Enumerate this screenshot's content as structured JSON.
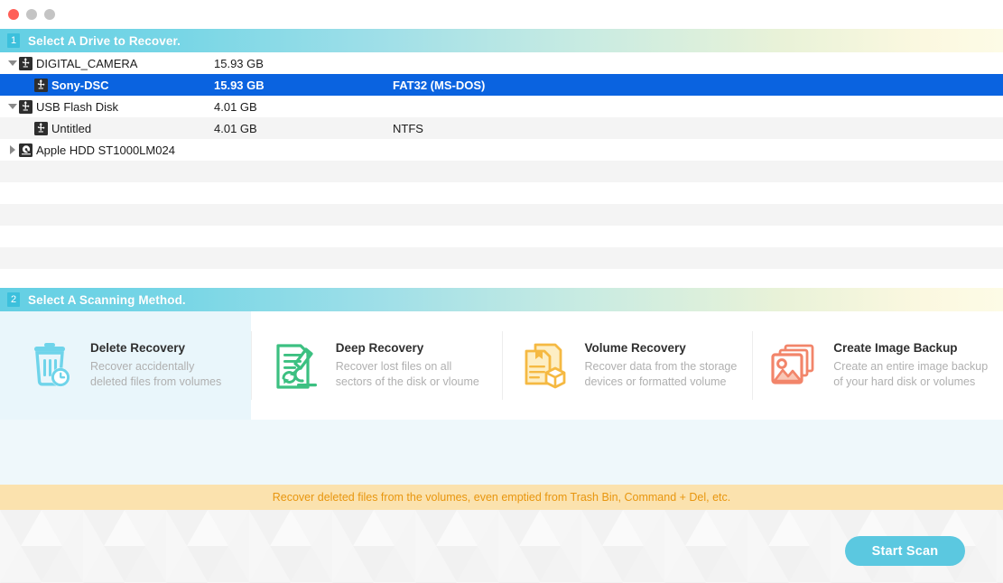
{
  "window": {
    "traffic_lights": [
      "close",
      "minimize",
      "zoom"
    ]
  },
  "step1": {
    "number": "1",
    "title": "Select A Drive to Recover.",
    "drives": [
      {
        "level": 0,
        "twisty": "open",
        "icon": "usb-icon",
        "name": "DIGITAL_CAMERA",
        "size": "15.93 GB",
        "filesystem": "",
        "selected": false,
        "shading": "plain"
      },
      {
        "level": 1,
        "twisty": "none",
        "icon": "usb-icon",
        "name": "Sony-DSC",
        "size": "15.93 GB",
        "filesystem": "FAT32 (MS-DOS)",
        "selected": true,
        "shading": "alt"
      },
      {
        "level": 0,
        "twisty": "open",
        "icon": "usb-icon",
        "name": "USB Flash Disk",
        "size": "4.01 GB",
        "filesystem": "",
        "selected": false,
        "shading": "plain"
      },
      {
        "level": 1,
        "twisty": "none",
        "icon": "usb-icon",
        "name": "Untitled",
        "size": "4.01 GB",
        "filesystem": "NTFS",
        "selected": false,
        "shading": "alt"
      },
      {
        "level": 0,
        "twisty": "closed",
        "icon": "hdd-icon",
        "name": "Apple HDD ST1000LM024",
        "size": "",
        "filesystem": "",
        "selected": false,
        "shading": "plain"
      },
      {
        "level": 0,
        "twisty": "none",
        "icon": "none",
        "name": "",
        "size": "",
        "filesystem": "",
        "selected": false,
        "shading": "alt"
      },
      {
        "level": 0,
        "twisty": "none",
        "icon": "none",
        "name": "",
        "size": "",
        "filesystem": "",
        "selected": false,
        "shading": "plain"
      },
      {
        "level": 0,
        "twisty": "none",
        "icon": "none",
        "name": "",
        "size": "",
        "filesystem": "",
        "selected": false,
        "shading": "alt"
      },
      {
        "level": 0,
        "twisty": "none",
        "icon": "none",
        "name": "",
        "size": "",
        "filesystem": "",
        "selected": false,
        "shading": "plain"
      },
      {
        "level": 0,
        "twisty": "none",
        "icon": "none",
        "name": "",
        "size": "",
        "filesystem": "",
        "selected": false,
        "shading": "alt"
      },
      {
        "level": 0,
        "twisty": "none",
        "icon": "none",
        "name": "",
        "size": "",
        "filesystem": "",
        "selected": false,
        "shading": "plain"
      }
    ]
  },
  "step2": {
    "number": "2",
    "title": "Select A Scanning Method.",
    "methods": [
      {
        "id": "delete",
        "icon": "trash-clock-icon",
        "title": "Delete Recovery",
        "desc_line1": "Recover accidentally",
        "desc_line2": "deleted files from volumes",
        "color": "#6fd4ea",
        "selected": true
      },
      {
        "id": "deep",
        "icon": "document-microscope-icon",
        "title": "Deep Recovery",
        "desc_line1": "Recover lost files on all",
        "desc_line2": "sectors of the disk or vloume",
        "color": "#3cc081",
        "selected": false
      },
      {
        "id": "volume",
        "icon": "document-box-icon",
        "title": "Volume Recovery",
        "desc_line1": "Recover data from the storage",
        "desc_line2": "devices or formatted volume",
        "color": "#f5b942",
        "selected": false
      },
      {
        "id": "image",
        "icon": "photo-stack-icon",
        "title": "Create Image Backup",
        "desc_line1": "Create an entire image backup",
        "desc_line2": "of your hard disk or volumes",
        "color": "#f2856a",
        "selected": false
      }
    ]
  },
  "hint": {
    "text": "Recover deleted files from the volumes, even emptied from Trash Bin, Command + Del, etc."
  },
  "actions": {
    "start_scan_label": "Start Scan"
  },
  "colors": {
    "header_gradient_start": "#63cfe4",
    "header_gradient_end": "#fdfbe6",
    "step_badge": "#3cc0dc",
    "selection_blue": "#0a63e0",
    "hint_bg": "#fbe2ae",
    "hint_text": "#e8960f",
    "start_button": "#5bc8e0",
    "selected_card_bg": "#e9f6fb"
  }
}
